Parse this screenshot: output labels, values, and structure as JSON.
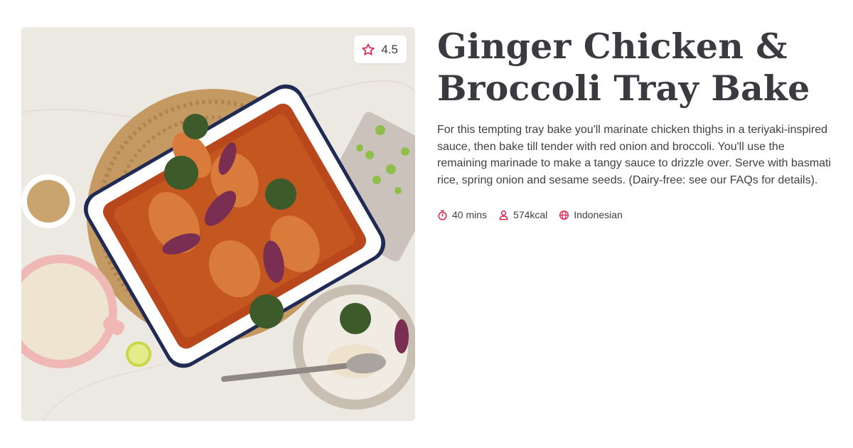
{
  "recipe": {
    "title": "Ginger Chicken & Broccoli Tray Bake",
    "description": "For this tempting tray bake you'll marinate chicken thighs in a teriyaki-inspired sauce, then bake till tender with red onion and broccoli. You'll use the remaining marinade to make a tangy sauce to drizzle over. Serve with basmati rice, spring onion and sesame seeds. (Dairy-free: see our FAQs for details).",
    "rating": "4.5",
    "meta": {
      "time": "40 mins",
      "calories": "574kcal",
      "cuisine": "Indonesian"
    }
  },
  "icons": {
    "rating": "star-outline-icon",
    "time": "timer-icon",
    "calories": "person-icon",
    "cuisine": "globe-icon"
  },
  "colors": {
    "accent": "#e0204b",
    "title": "#3a3a40",
    "body_text": "#3f3f46"
  }
}
